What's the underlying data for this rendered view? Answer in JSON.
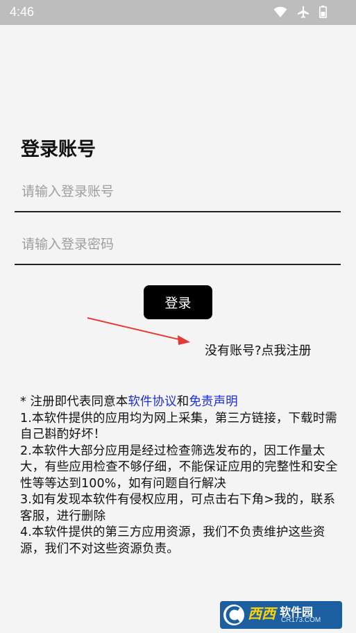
{
  "status_bar": {
    "time": "4:46",
    "icons": [
      "wifi-icon",
      "airplane-icon",
      "battery-icon"
    ]
  },
  "login": {
    "title": "登录账号",
    "account_placeholder": "请输入登录账号",
    "password_placeholder": "请输入登录密码",
    "login_label": "登录",
    "register_label": "没有账号?点我注册"
  },
  "notice": {
    "prefix": "* 注册即代表同意本",
    "agreement_link": "软件协议",
    "conjunction": "和",
    "disclaimer_link": "免责声明",
    "lines": [
      "1.本软件提供的应用均为网上采集，第三方链接，下载时需自己斟酌好坏！",
      "2.本软件大部分应用是经过检查筛选发布的，因工作量太大，有些应用检查不够仔细，不能保证应用的完整性和安全性等等达到100%，如有问题自行解决",
      "3.如有发现本软件有侵权应用，可点击右下角>我的，联系客服，进行删除",
      "4.本软件提供的第三方应用资源，我们不负责维护这些资源，我们不对这些资源负责。"
    ]
  },
  "watermark": {
    "brand": "西西",
    "site": "软件园",
    "url": "CR173.COM"
  },
  "colors": {
    "background": "#f4f4f4",
    "status_bar": "#bdbdbd",
    "button": "#000000",
    "link": "#1a2ee0",
    "arrow": "#e53935"
  }
}
